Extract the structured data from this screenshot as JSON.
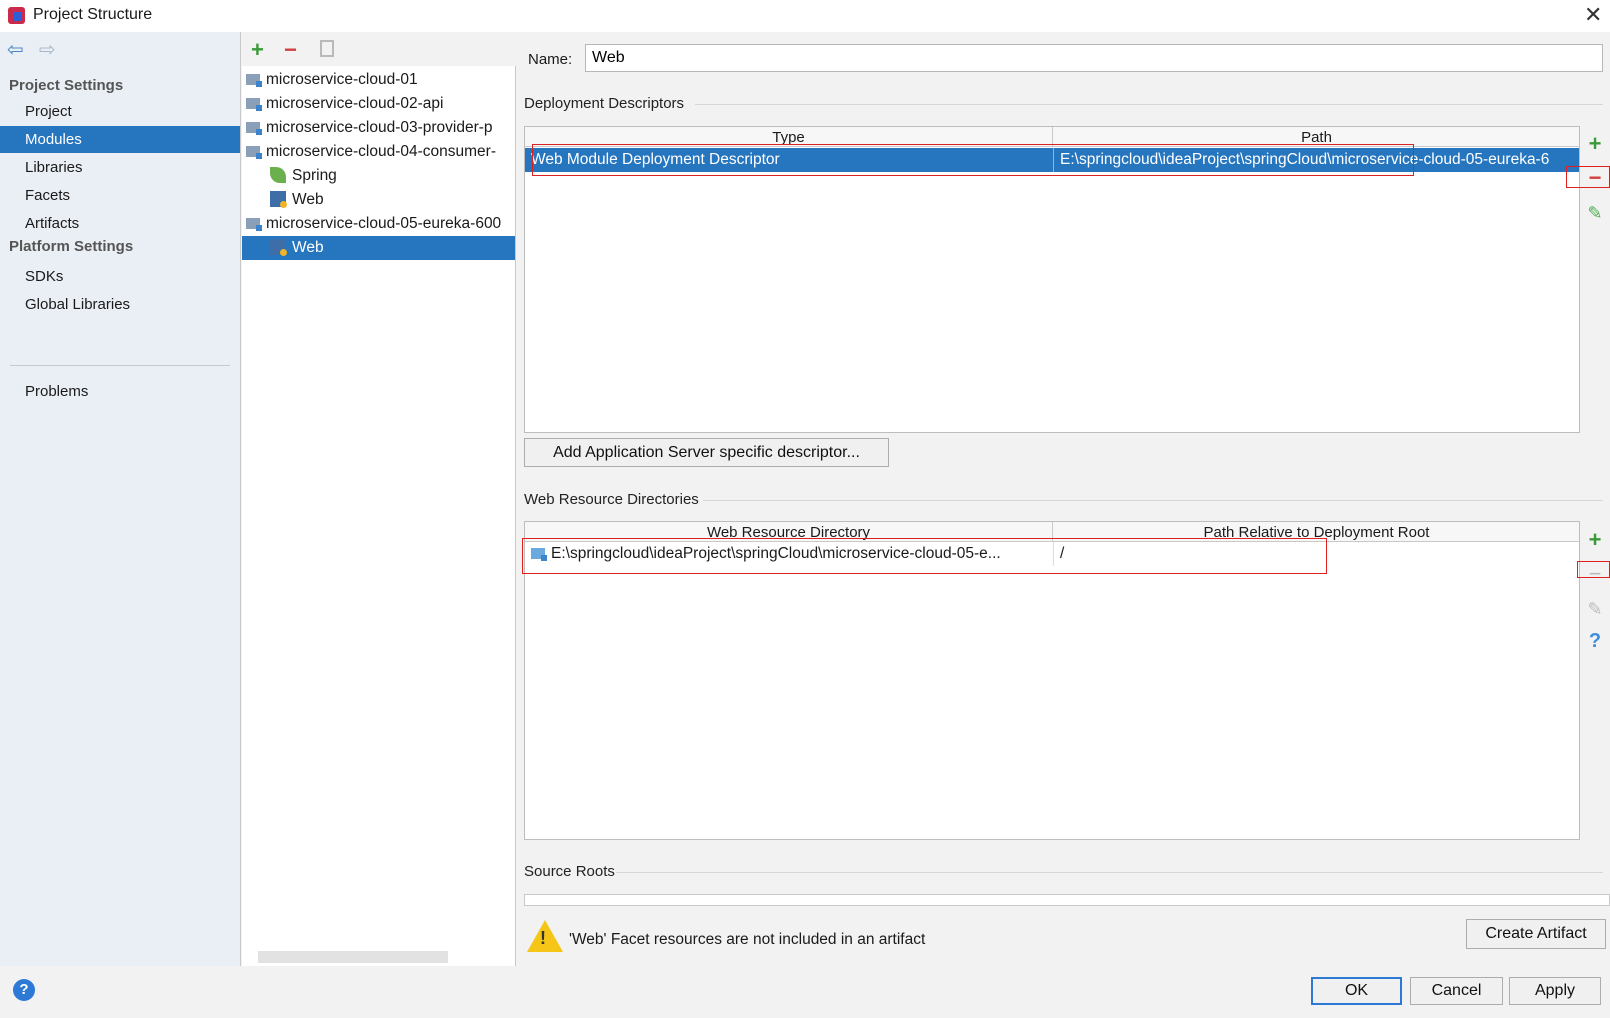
{
  "window": {
    "title": "Project Structure"
  },
  "nav": {
    "project_settings_header": "Project Settings",
    "project_items": [
      {
        "label": "Project",
        "selected": false
      },
      {
        "label": "Modules",
        "selected": true
      },
      {
        "label": "Libraries",
        "selected": false
      },
      {
        "label": "Facets",
        "selected": false
      },
      {
        "label": "Artifacts",
        "selected": false
      }
    ],
    "platform_settings_header": "Platform Settings",
    "platform_items": [
      {
        "label": "SDKs"
      },
      {
        "label": "Global Libraries"
      }
    ],
    "problems": "Problems"
  },
  "tree": {
    "toolbar": {
      "add": "+",
      "remove": "−"
    },
    "rows": [
      {
        "label": "microservice-cloud-01",
        "icon": "module-folder-icon",
        "indent": 0
      },
      {
        "label": "microservice-cloud-02-api",
        "icon": "module-folder-icon",
        "indent": 0
      },
      {
        "label": "microservice-cloud-03-provider-p",
        "icon": "module-folder-icon",
        "indent": 0
      },
      {
        "label": "microservice-cloud-04-consumer-",
        "icon": "module-folder-icon",
        "indent": 0
      },
      {
        "label": "Spring",
        "icon": "spring-icon",
        "indent": 1
      },
      {
        "label": "Web",
        "icon": "web-facet-icon",
        "indent": 1
      },
      {
        "label": "microservice-cloud-05-eureka-600",
        "icon": "module-folder-icon",
        "indent": 0
      },
      {
        "label": "Web",
        "icon": "web-facet-icon",
        "indent": 1,
        "selected": true
      }
    ]
  },
  "detail": {
    "name_label": "Name:",
    "name_value": "Web",
    "deployment_descriptors": {
      "title": "Deployment Descriptors",
      "columns": [
        "Type",
        "Path"
      ],
      "rows": [
        {
          "type": "Web Module Deployment Descriptor",
          "path": "E:\\springcloud\\ideaProject\\springCloud\\microservice-cloud-05-eureka-6"
        }
      ],
      "add_server_button": "Add Application Server specific descriptor..."
    },
    "web_resource_directories": {
      "title": "Web Resource Directories",
      "columns": [
        "Web Resource Directory",
        "Path Relative to Deployment Root"
      ],
      "rows": [
        {
          "directory": "E:\\springcloud\\ideaProject\\springCloud\\microservice-cloud-05-e...",
          "relative_path": "/"
        }
      ]
    },
    "source_roots": {
      "title": "Source Roots"
    },
    "warning": "'Web' Facet resources are not included in an artifact",
    "create_artifact_button": "Create Artifact"
  },
  "footer": {
    "ok": "OK",
    "cancel": "Cancel",
    "apply": "Apply",
    "help": "?"
  },
  "colors": {
    "selection": "#2675bf",
    "highlight_box": "#e02020",
    "add_green": "#3a9a3a",
    "remove_red": "#d04040"
  }
}
